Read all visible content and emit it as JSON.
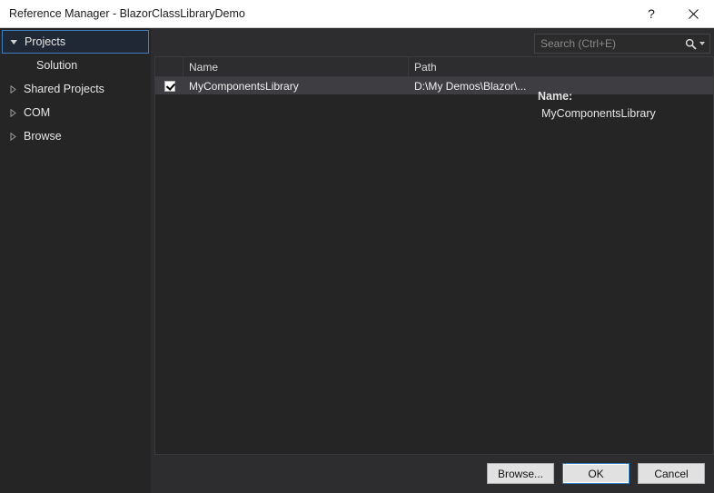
{
  "titlebar": {
    "title": "Reference Manager - BlazorClassLibraryDemo",
    "help_label": "?",
    "close_label": "×"
  },
  "sidebar": {
    "items": [
      {
        "label": "Projects",
        "expanded": true,
        "selected": true,
        "child": false
      },
      {
        "label": "Solution",
        "expanded": false,
        "selected": false,
        "child": true
      },
      {
        "label": "Shared Projects",
        "expanded": false,
        "selected": false,
        "child": false
      },
      {
        "label": "COM",
        "expanded": false,
        "selected": false,
        "child": false
      },
      {
        "label": "Browse",
        "expanded": false,
        "selected": false,
        "child": false
      }
    ]
  },
  "search": {
    "placeholder": "Search (Ctrl+E)",
    "value": "",
    "icon": "search-icon",
    "dropdown_icon": "chevron-down-icon"
  },
  "list": {
    "columns": [
      "",
      "Name",
      "Path"
    ],
    "rows": [
      {
        "checked": true,
        "name": "MyComponentsLibrary",
        "path": "D:\\My Demos\\Blazor\\..."
      }
    ]
  },
  "detail": {
    "name_label": "Name:",
    "name_value": "MyComponentsLibrary"
  },
  "footer": {
    "browse_label": "Browse...",
    "ok_label": "OK",
    "cancel_label": "Cancel"
  },
  "colors": {
    "dialog_bg": "#2d2d30",
    "panel_bg": "#252526",
    "row_selected": "#3e3e42",
    "accent_blue": "#3f7fbf",
    "titlebar_bg": "#ffffff",
    "button_bg": "#e1e1e1"
  }
}
